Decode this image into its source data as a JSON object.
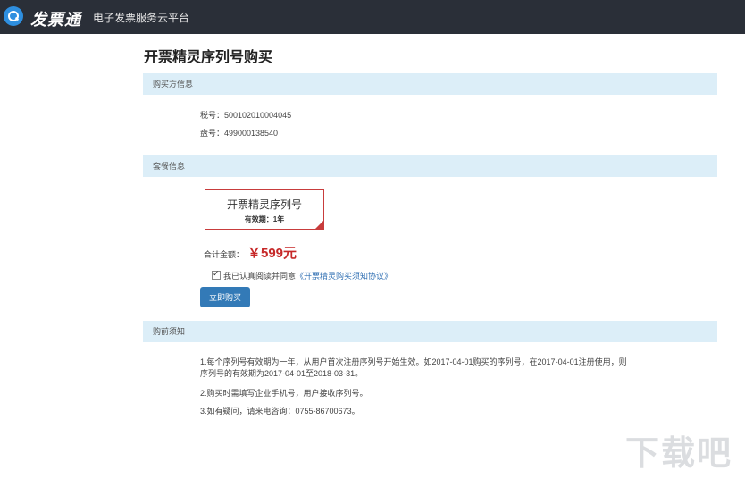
{
  "header": {
    "logo_text": "发票通",
    "platform_name": "电子发票服务云平台"
  },
  "page_title": "开票精灵序列号购买",
  "buyer_section": {
    "heading": "购买方信息",
    "tax_number": "税号：500102010004045",
    "disk_number": "盘号：499000138540"
  },
  "package_section": {
    "heading": "套餐信息",
    "package_name": "开票精灵序列号",
    "package_validity": "有效期：1年",
    "total_label": "合计金额：",
    "total_amount": "￥599元",
    "agreement_text": "我已认真阅读并同意",
    "agreement_link": "《开票精灵购买须知协议》",
    "agreement_checked": true,
    "buy_button": "立即购买"
  },
  "notice_section": {
    "heading": "购前须知",
    "lines": [
      "1.每个序列号有效期为一年，从用户首次注册序列号开始生效。如2017-04-01购买的序列号，在2017-04-01注册使用，则",
      "序列号的有效期为2017-04-01至2018-03-31。",
      "2.购买时需填写企业手机号，用户接收序列号。",
      "3.如有疑问，请来电咨询：0755-86700673。"
    ]
  },
  "watermark": "下载吧",
  "colors": {
    "header_bg": "#2a2f38",
    "section_bg": "#dceef8",
    "accent_red": "#c62828",
    "button_blue": "#337ab7"
  }
}
